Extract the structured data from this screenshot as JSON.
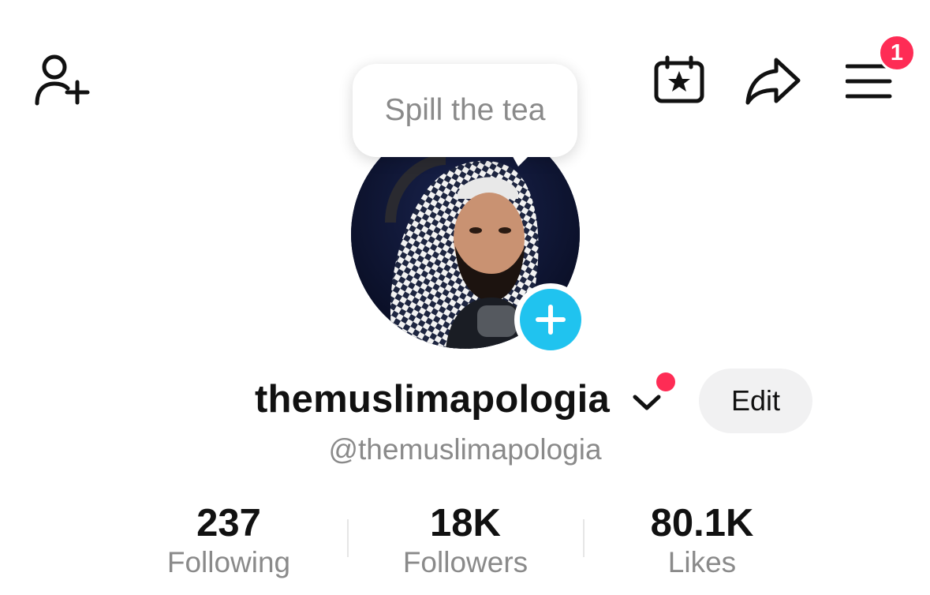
{
  "header": {
    "add_friend_icon": "person-plus-icon",
    "events_icon": "calendar-star-icon",
    "share_icon": "share-arrow-icon",
    "menu_icon": "hamburger-menu-icon",
    "menu_badge": "1"
  },
  "tooltip": {
    "text": "Spill the tea"
  },
  "profile": {
    "username": "themuslimapologia",
    "handle": "@themuslimapologia",
    "edit_label": "Edit"
  },
  "stats": [
    {
      "value": "237",
      "label": "Following"
    },
    {
      "value": "18K",
      "label": "Followers"
    },
    {
      "value": "80.1K",
      "label": "Likes"
    }
  ],
  "colors": {
    "accent_red": "#fe2c55",
    "accent_cyan": "#20c3ef",
    "secondary_text": "#8a8a8a"
  }
}
